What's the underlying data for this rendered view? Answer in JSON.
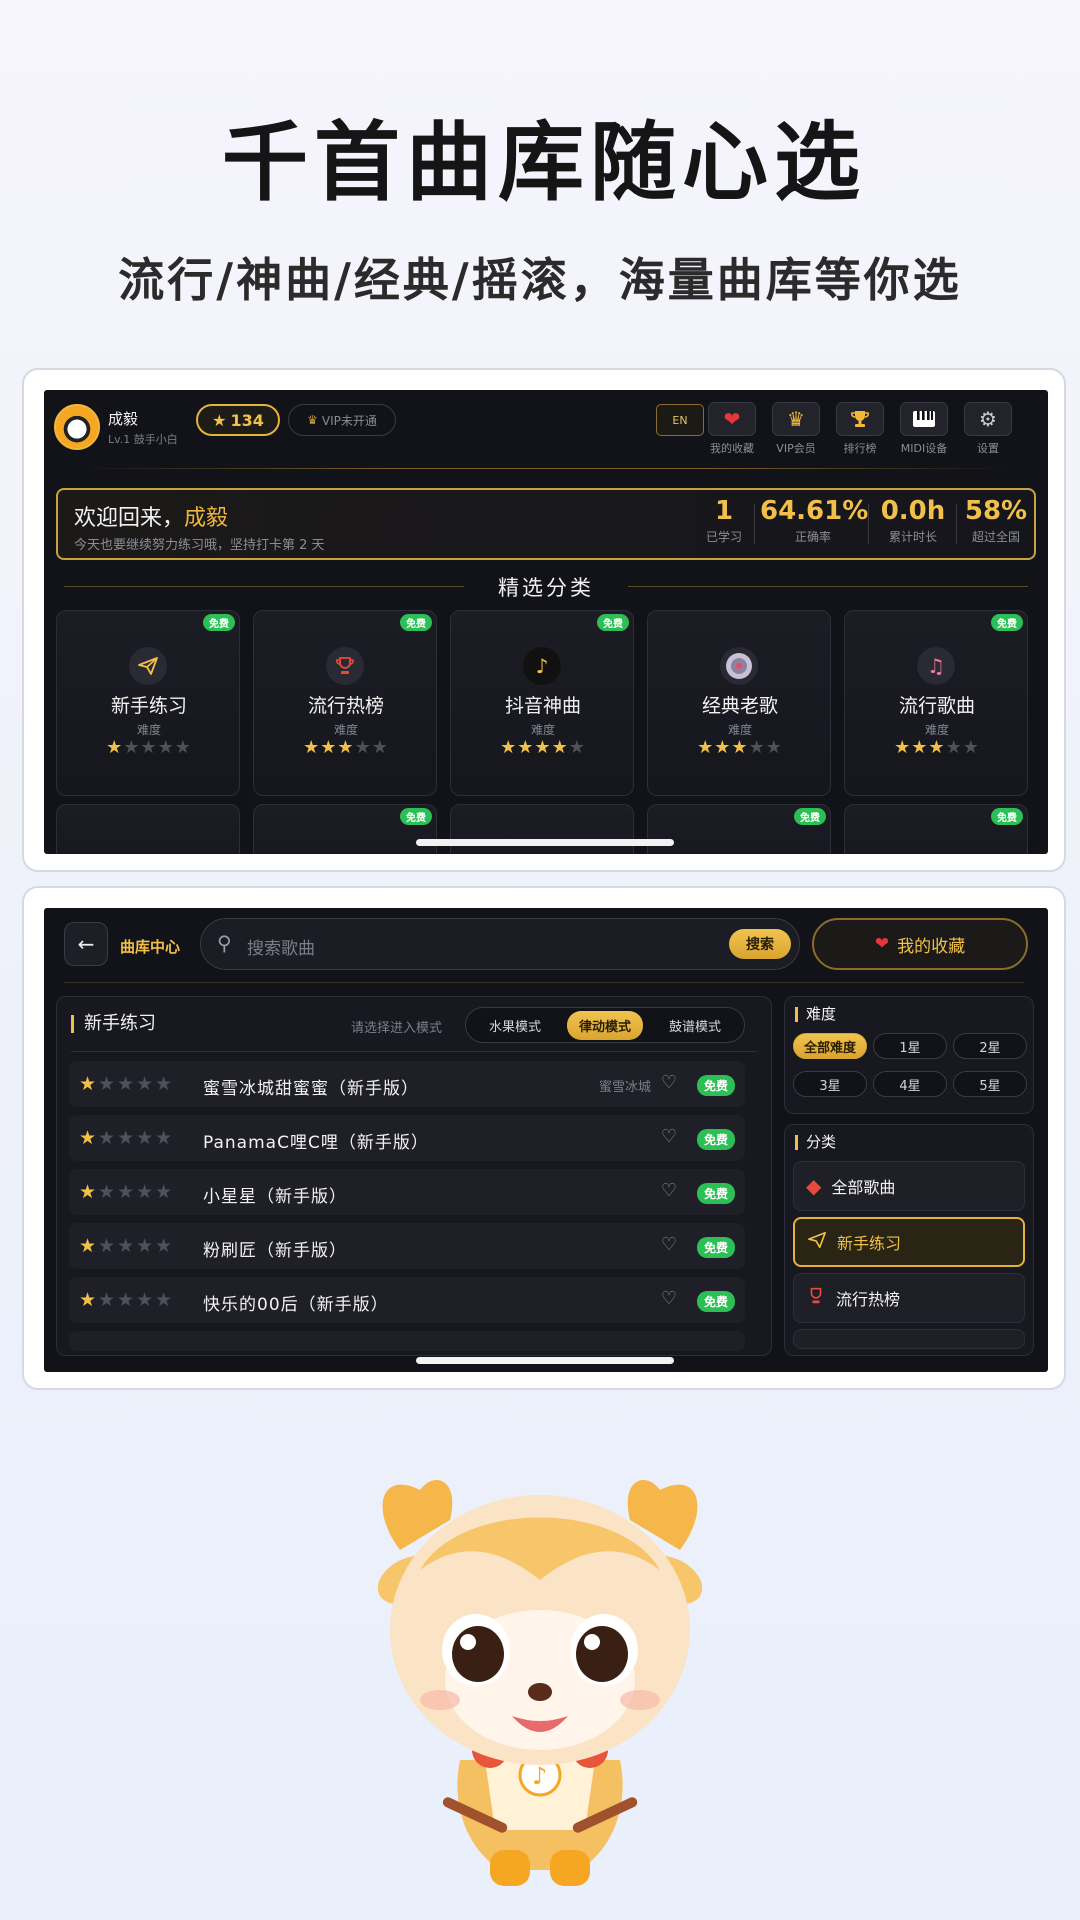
{
  "headline": {
    "title": "千首曲库随心选",
    "subtitle": "流行/神曲/经典/摇滚，海量曲库等你选"
  },
  "screen1": {
    "user": {
      "name": "成毅",
      "level": "Lv.1 鼓手小白"
    },
    "stars": "134",
    "vip": "VIP未开通",
    "lang": "EN",
    "tools": [
      {
        "label": "我的收藏",
        "icon": "heart-icon"
      },
      {
        "label": "VIP会员",
        "icon": "crown-icon"
      },
      {
        "label": "排行榜",
        "icon": "trophy-icon"
      },
      {
        "label": "MIDI设备",
        "icon": "piano-icon"
      },
      {
        "label": "设置",
        "icon": "gear-icon"
      }
    ],
    "welcome": {
      "greeting": "欢迎回来，",
      "name": "成毅",
      "sub": "今天也要继续努力练习哦，坚持打卡第 2 天",
      "stats": [
        {
          "value": "1",
          "label": "已学习"
        },
        {
          "value": "64.61%",
          "label": "正确率"
        },
        {
          "value": "0.0h",
          "label": "累计时长"
        },
        {
          "value": "58%",
          "label": "超过全国"
        }
      ]
    },
    "section_title": "精选分类",
    "free_label": "免费",
    "difficulty_label": "难度",
    "categories": [
      {
        "name": "新手练习",
        "stars": 1,
        "icon": "paper-plane-icon"
      },
      {
        "name": "流行热榜",
        "stars": 3,
        "icon": "trophy-icon"
      },
      {
        "name": "抖音神曲",
        "stars": 4,
        "icon": "tiktok-icon"
      },
      {
        "name": "经典老歌",
        "stars": 3,
        "icon": "vinyl-icon"
      },
      {
        "name": "流行歌曲",
        "stars": 3,
        "icon": "music-heart-icon"
      }
    ]
  },
  "screen2": {
    "title": "曲库中心",
    "search_placeholder": "搜索歌曲",
    "search_button": "搜索",
    "favorites": "我的收藏",
    "panel_title": "新手练习",
    "mode_hint": "请选择进入模式",
    "modes": [
      {
        "label": "水果模式",
        "active": false
      },
      {
        "label": "律动模式",
        "active": true
      },
      {
        "label": "鼓谱模式",
        "active": false
      }
    ],
    "songs": [
      {
        "title": "蜜雪冰城甜蜜蜜（新手版）",
        "artist": "蜜雪冰城",
        "stars": 1
      },
      {
        "title": "PanamaC哩C哩（新手版）",
        "artist": "",
        "stars": 1
      },
      {
        "title": "小星星（新手版）",
        "artist": "",
        "stars": 1
      },
      {
        "title": "粉刷匠（新手版）",
        "artist": "",
        "stars": 1
      },
      {
        "title": "快乐的00后（新手版）",
        "artist": "",
        "stars": 1
      }
    ],
    "free_label": "免费",
    "difficulty_title": "难度",
    "difficulty_options": [
      {
        "label": "全部难度",
        "active": true
      },
      {
        "label": "1星",
        "active": false
      },
      {
        "label": "2星",
        "active": false
      },
      {
        "label": "3星",
        "active": false
      },
      {
        "label": "4星",
        "active": false
      },
      {
        "label": "5星",
        "active": false
      }
    ],
    "category_title": "分类",
    "category_options": [
      {
        "label": "全部歌曲",
        "active": false,
        "icon": "layers-icon"
      },
      {
        "label": "新手练习",
        "active": true,
        "icon": "paper-plane-icon"
      },
      {
        "label": "流行热榜",
        "active": false,
        "icon": "trophy-icon"
      }
    ]
  },
  "colors": {
    "accent": "#f0c04a",
    "free_badge": "#2bbf55",
    "screen_bg": "#121219"
  }
}
